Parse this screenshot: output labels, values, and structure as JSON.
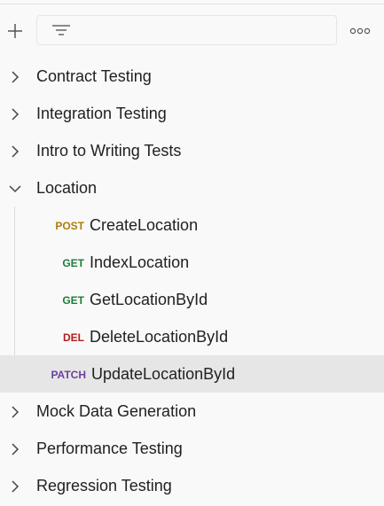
{
  "toolbar": {
    "add_icon": "plus-icon",
    "filter_icon": "filter-lines-icon",
    "filter_value": "",
    "more_icon": "ellipsis-icon"
  },
  "colors": {
    "post": "#b07d0b",
    "get": "#1d7d3a",
    "del": "#b01e1e",
    "patch": "#6b3fa0",
    "selected_row": "#e6e6e6"
  },
  "tree": {
    "folders": [
      {
        "label": "Contract Testing",
        "expanded": false
      },
      {
        "label": "Integration Testing",
        "expanded": false
      },
      {
        "label": "Intro to Writing Tests",
        "expanded": false
      },
      {
        "label": "Location",
        "expanded": true,
        "requests": [
          {
            "method": "POST",
            "label": "CreateLocation"
          },
          {
            "method": "GET",
            "label": "IndexLocation"
          },
          {
            "method": "GET",
            "label": "GetLocationById"
          },
          {
            "method": "DEL",
            "label": "DeleteLocationById"
          },
          {
            "method": "PATCH",
            "label": "UpdateLocationById",
            "selected": true
          }
        ]
      },
      {
        "label": "Mock Data Generation",
        "expanded": false
      },
      {
        "label": "Performance Testing",
        "expanded": false
      },
      {
        "label": "Regression Testing",
        "expanded": false
      }
    ]
  }
}
